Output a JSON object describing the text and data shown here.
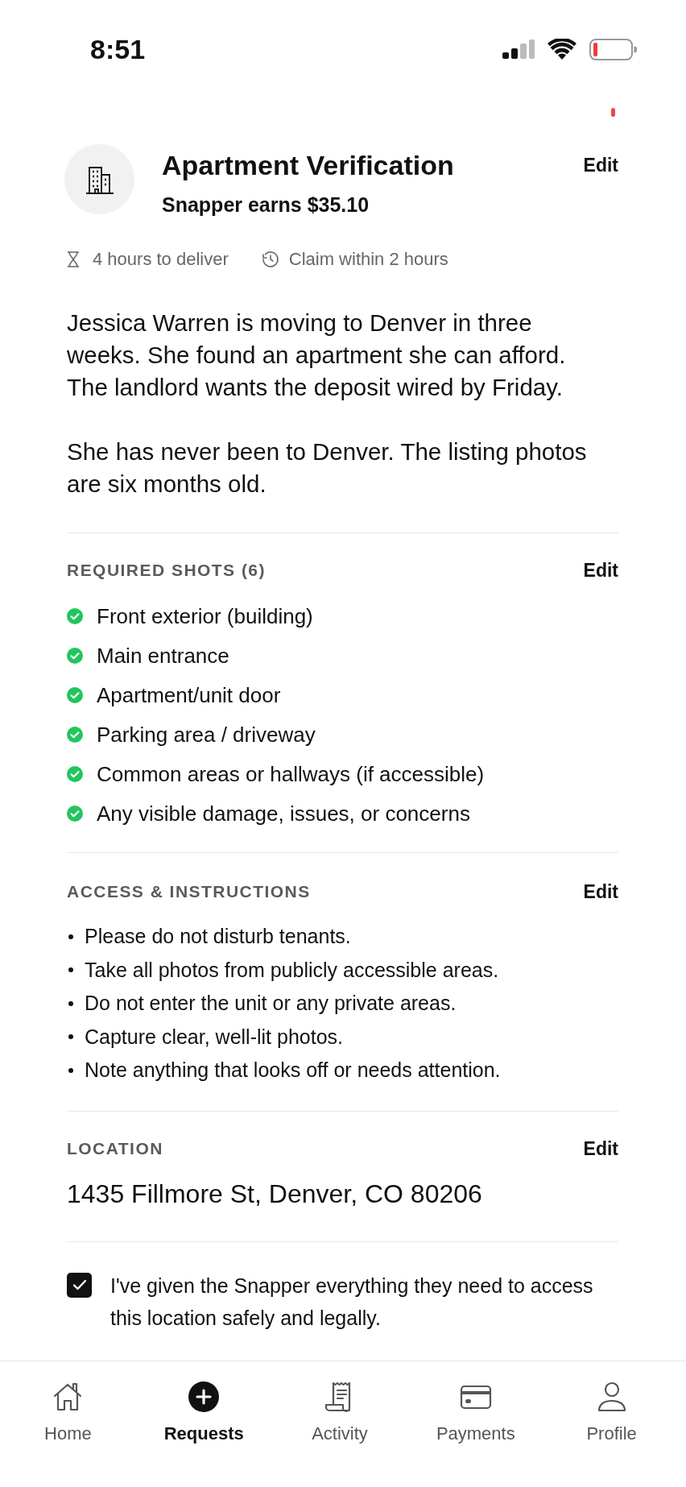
{
  "status_bar": {
    "time": "8:51"
  },
  "header": {
    "title": "Apartment Verification",
    "earnings": "Snapper earns $35.10",
    "edit": "Edit"
  },
  "meta": [
    {
      "kind": "hourglass",
      "text": "4 hours to deliver"
    },
    {
      "kind": "clock",
      "text": "Claim within 2 hours"
    }
  ],
  "description": [
    "Jessica Warren is moving to Denver in three weeks. She found an apartment she can afford. The landlord wants the deposit wired by Friday.",
    "She has never been to Denver. The listing photos are six months old."
  ],
  "required_shots": {
    "title": "REQUIRED SHOTS (6)",
    "edit": "Edit",
    "items": [
      {
        "label": "Front exterior (building)",
        "checked": true
      },
      {
        "label": "Main entrance",
        "checked": true
      },
      {
        "label": "Apartment/unit door",
        "checked": true
      },
      {
        "label": "Parking area / driveway",
        "checked": true
      },
      {
        "label": "Common areas or hallways (if accessible)",
        "checked": true
      },
      {
        "label": "Any visible damage, issues, or concerns",
        "checked": true
      }
    ]
  },
  "access": {
    "title": "ACCESS & INSTRUCTIONS",
    "edit": "Edit",
    "items": [
      "Please do not disturb tenants.",
      "Take all photos from publicly accessible areas.",
      "Do not enter the unit or any private areas.",
      "Capture clear, well-lit photos.",
      "Note anything that looks off or needs attention."
    ]
  },
  "location": {
    "title": "LOCATION",
    "edit": "Edit",
    "address": "1435 Fillmore St, Denver, CO 80206"
  },
  "consent": {
    "label": "I've given the Snapper everything they need to access this location safely and legally.",
    "checked": true
  },
  "nav": [
    {
      "kind": "home",
      "label": "Home",
      "selected": false
    },
    {
      "kind": "requests",
      "label": "Requests",
      "selected": true
    },
    {
      "kind": "activity",
      "label": "Activity",
      "selected": false
    },
    {
      "kind": "payments",
      "label": "Payments",
      "selected": false
    },
    {
      "kind": "profile",
      "label": "Profile",
      "selected": false
    }
  ]
}
